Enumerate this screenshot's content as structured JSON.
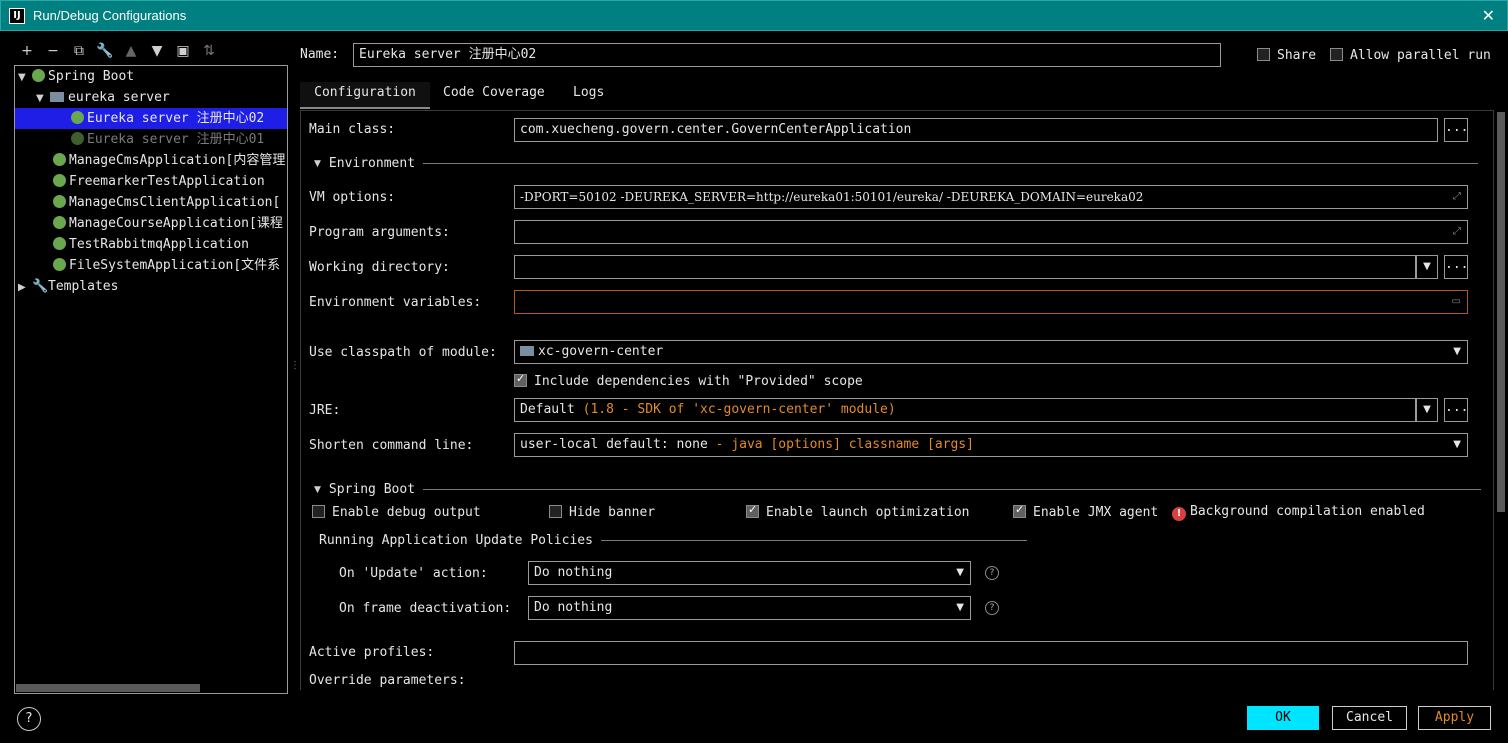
{
  "window": {
    "title": "Run/Debug Configurations",
    "logo": "IJ",
    "close_glyph": "✕"
  },
  "toolbar": {
    "icons": [
      "add-icon",
      "remove-icon",
      "copy-icon",
      "wrench-icon",
      "move-up-icon",
      "move-down-icon",
      "new-folder-icon",
      "sort-icon"
    ]
  },
  "tree": {
    "spring_boot": "Spring Boot",
    "folder": "eureka server",
    "item_selected": "Eureka server 注册中心02",
    "item_dim": "Eureka server 注册中心01",
    "apps": [
      "ManageCmsApplication[内容管理",
      "FreemarkerTestApplication",
      "ManageCmsClientApplication[",
      "ManageCourseApplication[课程",
      "TestRabbitmqApplication",
      "FileSystemApplication[文件系"
    ],
    "templates": "Templates"
  },
  "header": {
    "name_label": "Name:",
    "name_value": "Eureka server 注册中心02",
    "share": "Share",
    "allow_parallel": "Allow parallel run"
  },
  "tabs": [
    "Configuration",
    "Code Coverage",
    "Logs"
  ],
  "config": {
    "main_class_label": "Main class:",
    "main_class_value": "com.xuecheng.govern.center.GovernCenterApplication",
    "environment": "Environment",
    "vm_label": "VM options:",
    "vm_value": "-DPORT=50102 -DEUREKA_SERVER=http://eureka01:50101/eureka/ -DEUREKA_DOMAIN=eureka02",
    "program_args_label": "Program arguments:",
    "working_dir_label": "Working directory:",
    "env_vars_label": "Environment variables:",
    "classpath_label": "Use classpath of module:",
    "classpath_value": "xc-govern-center",
    "include_deps": "Include dependencies with \"Provided\" scope",
    "jre_label": "JRE:",
    "jre_default": "Default",
    "jre_detail": "(1.8 - SDK of 'xc-govern-center' module)",
    "shorten_label": "Shorten command line:",
    "shorten_value": "user-local default: none",
    "shorten_detail": "- java [options] classname [args]",
    "ellipsis": "...",
    "spring_boot": "Spring Boot",
    "enable_debug": "Enable debug output",
    "hide_banner": "Hide banner",
    "launch_opt": "Enable launch optimization",
    "jmx": "Enable JMX agent",
    "bg_compile": "Background compilation enabled",
    "policies": "Running Application Update Policies",
    "update_label": "On 'Update' action:",
    "update_value": "Do nothing",
    "frame_label": "On frame deactivation:",
    "frame_value": "Do nothing",
    "active_profiles_label": "Active profiles:",
    "override_label": "Override parameters:"
  },
  "footer": {
    "help": "?",
    "ok": "OK",
    "cancel": "Cancel",
    "apply": "Apply"
  },
  "colors": {
    "titlebar": "#008080",
    "selection": "#1e1ee6",
    "ok_button": "#00e5ff",
    "accent_orange": "#e08a2a",
    "leaf": "#6aa84f"
  }
}
